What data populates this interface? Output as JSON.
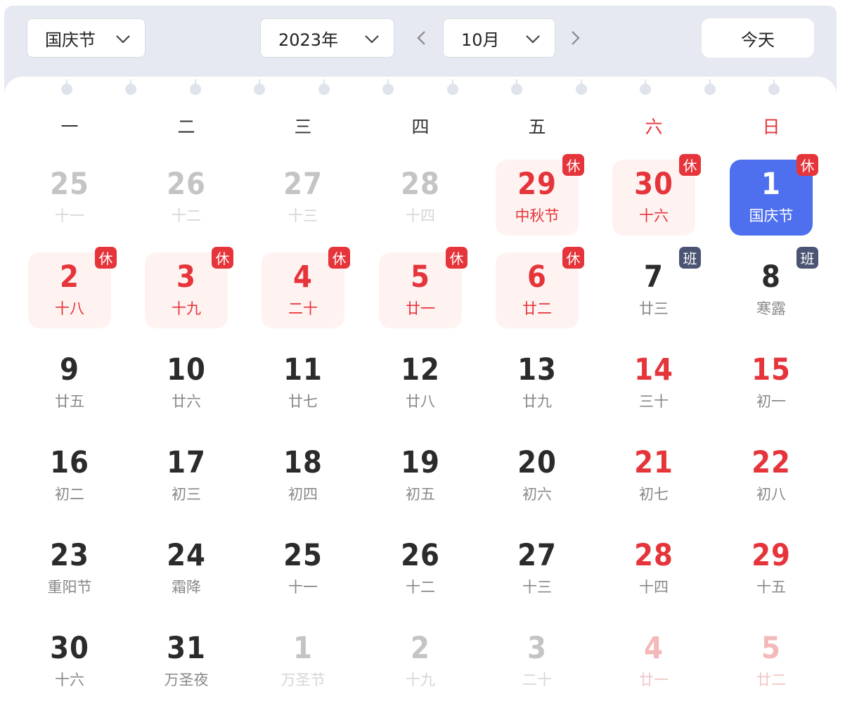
{
  "toolbar": {
    "holiday": "国庆节",
    "year": "2023年",
    "month": "10月",
    "today_label": "今天"
  },
  "weekdays": [
    "一",
    "二",
    "三",
    "四",
    "五",
    "六",
    "日"
  ],
  "days": [
    {
      "num": "25",
      "lunar": "十一",
      "state": "other"
    },
    {
      "num": "26",
      "lunar": "十二",
      "state": "other"
    },
    {
      "num": "27",
      "lunar": "十三",
      "state": "other"
    },
    {
      "num": "28",
      "lunar": "十四",
      "state": "other"
    },
    {
      "num": "29",
      "lunar": "中秋节",
      "state": "rest",
      "tag": "休"
    },
    {
      "num": "30",
      "lunar": "十六",
      "state": "rest",
      "tag": "休"
    },
    {
      "num": "1",
      "lunar": "国庆节",
      "state": "selected",
      "tag": "休"
    },
    {
      "num": "2",
      "lunar": "十八",
      "state": "rest",
      "tag": "休"
    },
    {
      "num": "3",
      "lunar": "十九",
      "state": "rest",
      "tag": "休"
    },
    {
      "num": "4",
      "lunar": "二十",
      "state": "rest",
      "tag": "休"
    },
    {
      "num": "5",
      "lunar": "廿一",
      "state": "rest",
      "tag": "休"
    },
    {
      "num": "6",
      "lunar": "廿二",
      "state": "rest",
      "tag": "休"
    },
    {
      "num": "7",
      "lunar": "廿三",
      "state": "normal",
      "tag": "班"
    },
    {
      "num": "8",
      "lunar": "寒露",
      "state": "normal",
      "tag": "班"
    },
    {
      "num": "9",
      "lunar": "廿五",
      "state": "normal"
    },
    {
      "num": "10",
      "lunar": "廿六",
      "state": "normal"
    },
    {
      "num": "11",
      "lunar": "廿七",
      "state": "normal"
    },
    {
      "num": "12",
      "lunar": "廿八",
      "state": "normal"
    },
    {
      "num": "13",
      "lunar": "廿九",
      "state": "normal"
    },
    {
      "num": "14",
      "lunar": "三十",
      "state": "weekend"
    },
    {
      "num": "15",
      "lunar": "初一",
      "state": "weekend"
    },
    {
      "num": "16",
      "lunar": "初二",
      "state": "normal"
    },
    {
      "num": "17",
      "lunar": "初三",
      "state": "normal"
    },
    {
      "num": "18",
      "lunar": "初四",
      "state": "normal"
    },
    {
      "num": "19",
      "lunar": "初五",
      "state": "normal"
    },
    {
      "num": "20",
      "lunar": "初六",
      "state": "normal"
    },
    {
      "num": "21",
      "lunar": "初七",
      "state": "weekend"
    },
    {
      "num": "22",
      "lunar": "初八",
      "state": "weekend"
    },
    {
      "num": "23",
      "lunar": "重阳节",
      "state": "normal"
    },
    {
      "num": "24",
      "lunar": "霜降",
      "state": "normal"
    },
    {
      "num": "25",
      "lunar": "十一",
      "state": "normal"
    },
    {
      "num": "26",
      "lunar": "十二",
      "state": "normal"
    },
    {
      "num": "27",
      "lunar": "十三",
      "state": "normal"
    },
    {
      "num": "28",
      "lunar": "十四",
      "state": "weekend"
    },
    {
      "num": "29",
      "lunar": "十五",
      "state": "weekend"
    },
    {
      "num": "30",
      "lunar": "十六",
      "state": "normal"
    },
    {
      "num": "31",
      "lunar": "万圣夜",
      "state": "normal"
    },
    {
      "num": "1",
      "lunar": "万圣节",
      "state": "other"
    },
    {
      "num": "2",
      "lunar": "十九",
      "state": "other"
    },
    {
      "num": "3",
      "lunar": "二十",
      "state": "other"
    },
    {
      "num": "4",
      "lunar": "廿一",
      "state": "other-weekend"
    },
    {
      "num": "5",
      "lunar": "廿二",
      "state": "other-weekend"
    }
  ],
  "colors": {
    "accent": "#4e70ee",
    "holiday_red": "#e5343a",
    "work_tag": "#4b5472",
    "rest_bg": "#fff3f2"
  }
}
